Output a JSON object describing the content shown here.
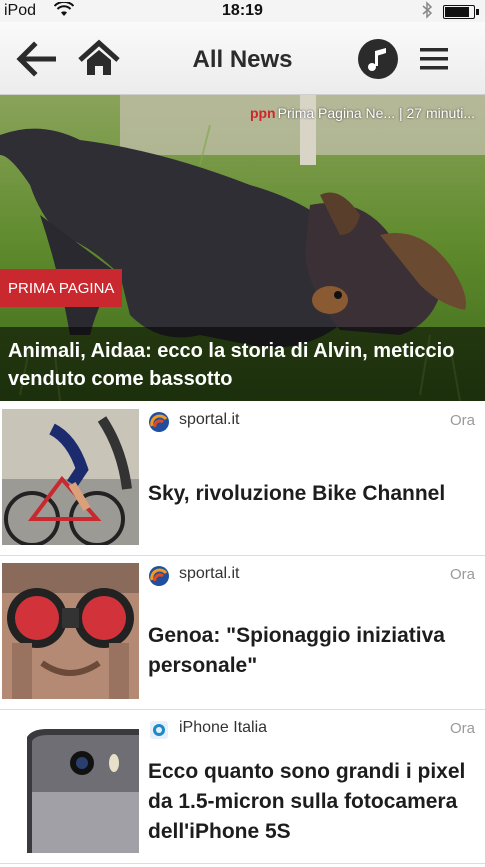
{
  "status_bar": {
    "carrier": "iPod",
    "time": "18:19",
    "battery_level": 0.8
  },
  "nav": {
    "title": "All News",
    "icons": [
      "back-arrow-icon",
      "home-icon",
      "music-icon",
      "hamburger-menu-icon"
    ]
  },
  "hero": {
    "source_logo": "ppn",
    "source_line": "Prima Pagina Ne... | 27 minuti...",
    "badge": "PRIMA PAGINA",
    "headline": "Animali, Aidaa: ecco la storia di Alvin, meticcio venduto come bassotto",
    "badge_color": "#c9282e"
  },
  "news": [
    {
      "source": "sportal.it",
      "time": "Ora",
      "headline": "Sky, rivoluzione Bike Channel",
      "icon": "sportal-logo-icon"
    },
    {
      "source": "sportal.it",
      "time": "Ora",
      "headline": "Genoa: \"Spionaggio iniziativa personale\"",
      "icon": "sportal-logo-icon"
    },
    {
      "source": "iPhone Italia",
      "time": "Ora",
      "headline": "Ecco quanto sono grandi i pixel da 1.5-micron sulla fotocamera dell'iPhone 5S",
      "icon": "iphone-italia-logo-icon"
    }
  ]
}
